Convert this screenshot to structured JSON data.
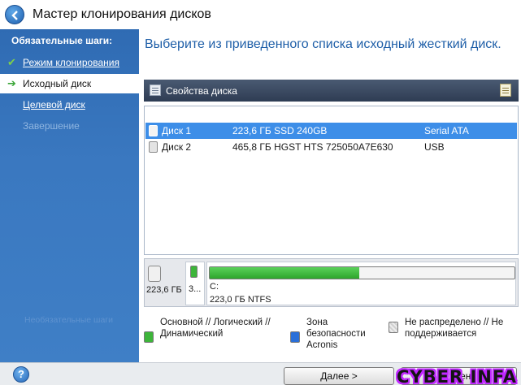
{
  "window": {
    "title": "Мастер клонирования дисков"
  },
  "sidebar": {
    "heading": "Обязательные шаги:",
    "steps": [
      {
        "label": "Режим клонирования",
        "state": "done",
        "mark": "✔"
      },
      {
        "label": "Исходный диск",
        "state": "active",
        "mark": "➔"
      },
      {
        "label": "Целевой диск",
        "state": "next"
      },
      {
        "label": "Завершение",
        "state": "disabled"
      }
    ],
    "optional_heading": "Необязательные шаги"
  },
  "main": {
    "instruction": "Выберите из приведенного списка исходный жесткий диск.",
    "toolbar": {
      "properties_label": "Свойства диска"
    },
    "disks": [
      {
        "name": "Диск 1",
        "capacity_model": "223,6 ГБ SSD 240GB",
        "interface": "Serial ATA",
        "selected": true
      },
      {
        "name": "Диск 2",
        "capacity_model": "465,8 ГБ HGST HTS 725050A7E630",
        "interface": "USB",
        "selected": false
      }
    ],
    "disk_map": {
      "disk_size": "223,6 ГБ",
      "small_partition_label": "3...",
      "partition": {
        "letter": "C:",
        "size_fs": "223,0 ГБ  NTFS",
        "used_fraction": 0.49
      }
    },
    "legend": [
      {
        "text": "Основной // Логический // Динамический",
        "color": "#3db53a"
      },
      {
        "text": "Зона безопасности Acronis",
        "color": "#2a6fd8"
      },
      {
        "text": "Не распределено // Не поддерживается",
        "color": "#d0d0d0"
      }
    ]
  },
  "footer": {
    "help_label": "?",
    "next_label": "Далее >",
    "cancel_label": "Отмена"
  },
  "watermark": {
    "text": "CYBER INFA"
  },
  "colors": {
    "sidebar": "#3a78c0",
    "title_blue": "#1f5fa8",
    "selection": "#3d8ee8",
    "primary_partition": "#3db53a"
  }
}
